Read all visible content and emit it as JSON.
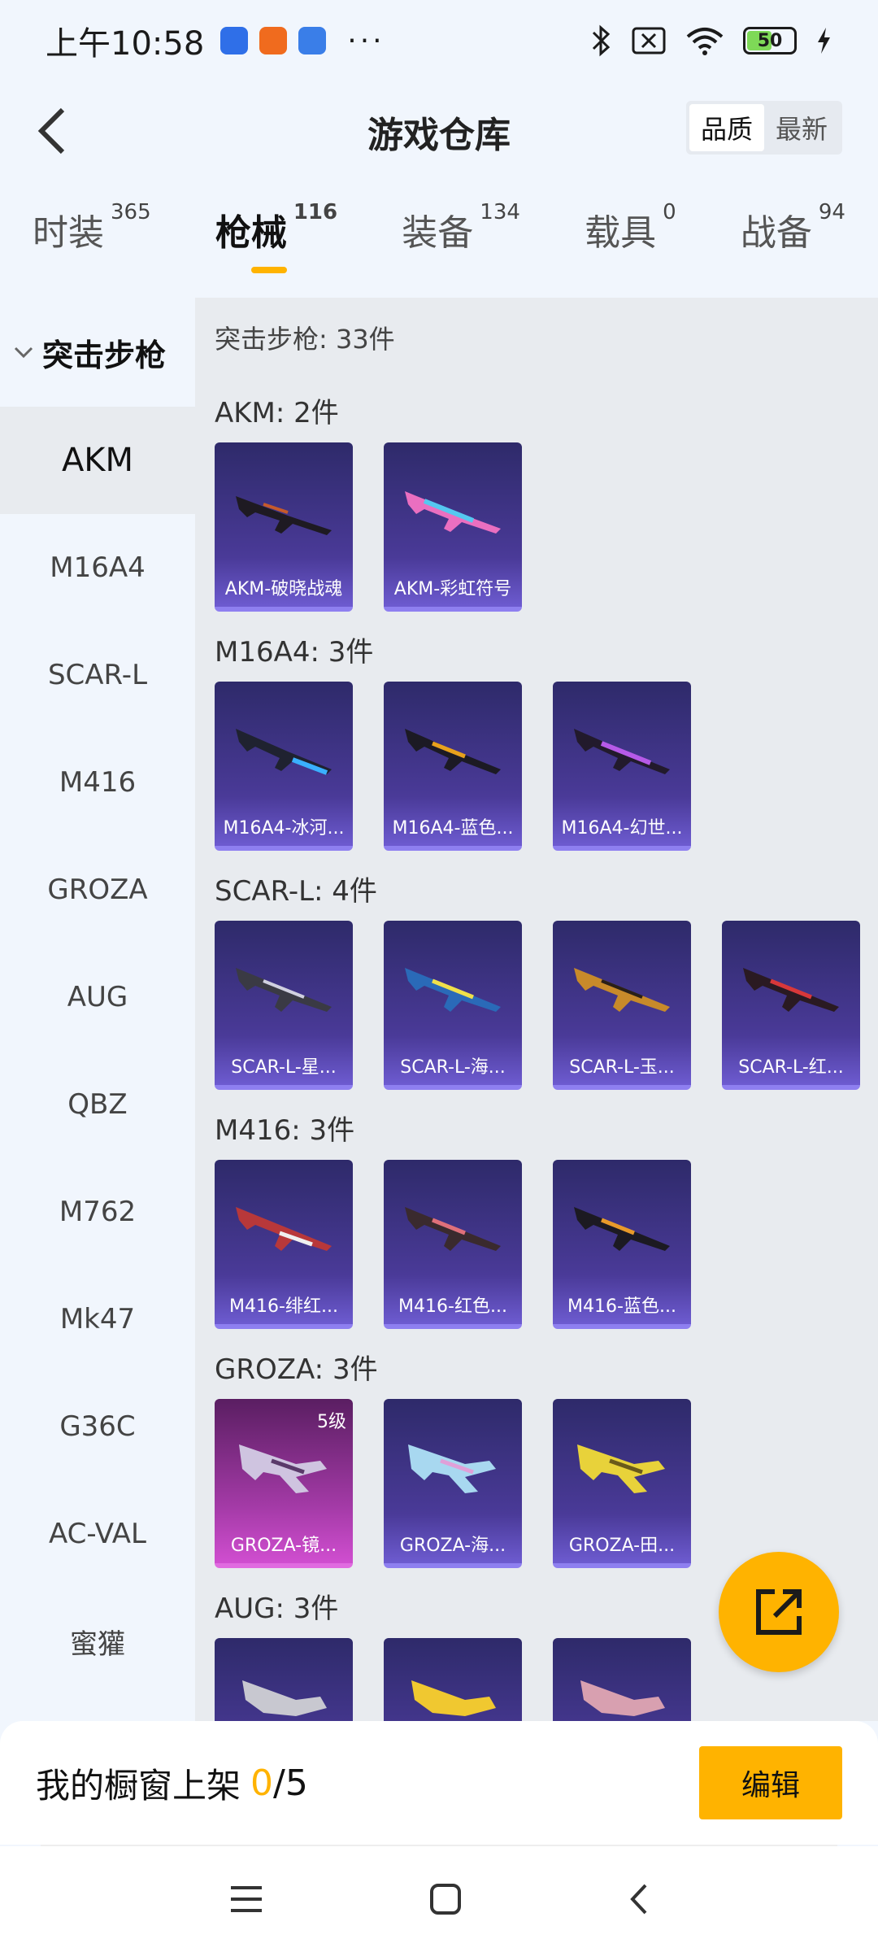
{
  "status_bar": {
    "time": "上午10:58",
    "more": "···",
    "battery": "50"
  },
  "header": {
    "title": "游戏仓库",
    "sort_options": [
      "品质",
      "最新"
    ],
    "sort_selected": "品质"
  },
  "tabs": [
    {
      "label": "时装",
      "count": "365"
    },
    {
      "label": "枪械",
      "count": "116",
      "active": true
    },
    {
      "label": "装备",
      "count": "134"
    },
    {
      "label": "载具",
      "count": "0"
    },
    {
      "label": "战备",
      "count": "94"
    }
  ],
  "sidebar": {
    "section": "突击步枪",
    "items": [
      "AKM",
      "M16A4",
      "SCAR-L",
      "M416",
      "GROZA",
      "AUG",
      "QBZ",
      "M762",
      "Mk47",
      "G36C",
      "AC-VAL",
      "蜜獾"
    ],
    "active": "AKM"
  },
  "main": {
    "total": "突击步枪: 33件",
    "groups": [
      {
        "title": "AKM: 2件",
        "items": [
          {
            "name": "AKM-破晓战魂",
            "color": "#3a2e7a"
          },
          {
            "name": "AKM-彩虹符号",
            "color": "#3a2e7a"
          }
        ]
      },
      {
        "title": "M16A4: 3件",
        "items": [
          {
            "name": "M16A4-冰河..."
          },
          {
            "name": "M16A4-蓝色..."
          },
          {
            "name": "M16A4-幻世..."
          }
        ]
      },
      {
        "title": "SCAR-L: 4件",
        "items": [
          {
            "name": "SCAR-L-星..."
          },
          {
            "name": "SCAR-L-海..."
          },
          {
            "name": "SCAR-L-玉..."
          },
          {
            "name": "SCAR-L-红..."
          }
        ]
      },
      {
        "title": "M416: 3件",
        "items": [
          {
            "name": "M416-绯红..."
          },
          {
            "name": "M416-红色..."
          },
          {
            "name": "M416-蓝色..."
          }
        ]
      },
      {
        "title": "GROZA: 3件",
        "items": [
          {
            "name": "GROZA-镜...",
            "level": "5级"
          },
          {
            "name": "GROZA-海..."
          },
          {
            "name": "GROZA-田..."
          }
        ]
      },
      {
        "title": "AUG: 3件",
        "items": [
          {
            "name": ""
          },
          {
            "name": ""
          },
          {
            "name": ""
          }
        ]
      }
    ]
  },
  "shelf": {
    "label": "我的橱窗上架",
    "current": "0",
    "total": "/5",
    "edit_label": "编辑"
  },
  "colors": {
    "accent": "#ffb300",
    "card_purple": "#4a3a98",
    "card_pink": "#a33aa6"
  }
}
